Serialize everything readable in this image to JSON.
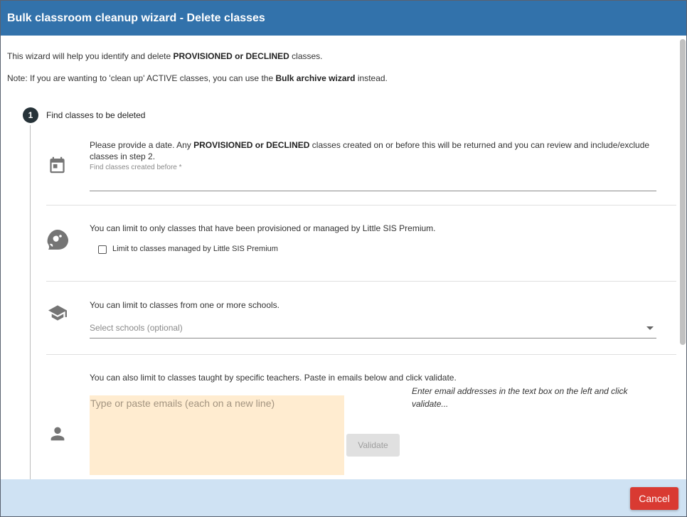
{
  "header": {
    "title": "Bulk classroom cleanup wizard - Delete classes"
  },
  "intro": {
    "line1_before": "This wizard will help you identify and delete ",
    "line1_bold": "PROVISIONED or DECLINED",
    "line1_after": " classes.",
    "line2_before": "Note: If you are wanting to 'clean up' ACTIVE classes, you can use the ",
    "line2_bold": "Bulk archive wizard",
    "line2_after": " instead."
  },
  "step": {
    "number": "1",
    "title": "Find classes to be deleted"
  },
  "date_section": {
    "text_before": "Please provide a date. Any ",
    "text_bold": "PROVISIONED or DECLINED",
    "text_after_line1": " classes created on or before this will be returned and you can review and include/exclude",
    "text_line2": "classes in step 2.",
    "field_label": "Find classes created before *",
    "value": "",
    "icon": "calendar-icon"
  },
  "sis_section": {
    "text": "You can limit to only classes that have been provisioned or managed by Little SIS Premium.",
    "checkbox_label": "Limit to classes managed by Little SIS Premium",
    "checked": false,
    "icon": "penguin-icon"
  },
  "schools_section": {
    "text": "You can limit to classes from one or more schools.",
    "placeholder": "Select schools (optional)",
    "icon": "graduation-cap-icon"
  },
  "teachers_section": {
    "text": "You can also limit to classes taught by specific teachers. Paste in emails below and click validate.",
    "placeholder": "Type or paste emails (each on a new line)",
    "hint": "Enter email addresses in the text box on the left and click validate...",
    "validate_label": "Validate",
    "icon": "person-icon"
  },
  "footer": {
    "cancel_label": "Cancel"
  },
  "colors": {
    "header": "#3272ab",
    "footer": "#cfe2f3",
    "cancel": "#d93a32",
    "email_box": "#ffecd0"
  }
}
